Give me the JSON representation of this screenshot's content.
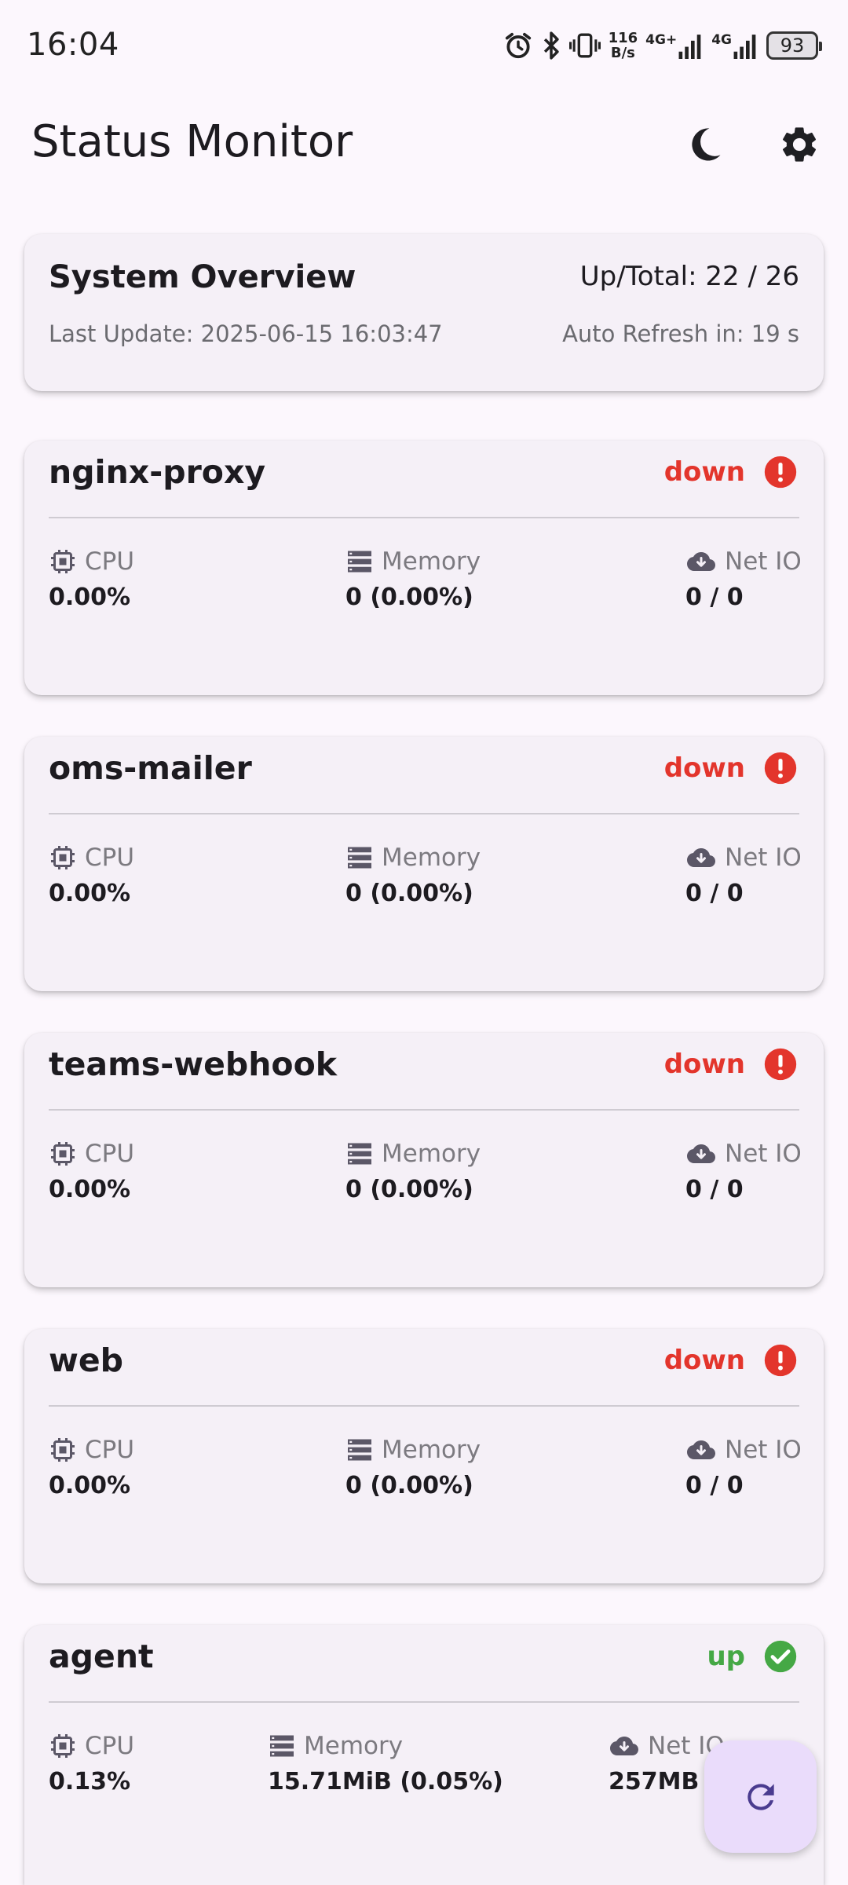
{
  "status_bar": {
    "time": "16:04",
    "net_speed_value": "116",
    "net_speed_unit": "B/s",
    "net_label_1": "4G+",
    "net_label_2": "4G",
    "battery": "93"
  },
  "app_bar": {
    "title": "Status Monitor",
    "icons": [
      "moon-icon",
      "gear-icon"
    ]
  },
  "overview": {
    "title": "System Overview",
    "up_total": "Up/Total: 22 / 26",
    "last_update": "Last Update: 2025-06-15 16:03:47",
    "auto_refresh": "Auto Refresh in: 19 s"
  },
  "metric_labels": {
    "cpu": "CPU",
    "memory": "Memory",
    "net_io": "Net IO"
  },
  "services": [
    {
      "name": "nginx-proxy",
      "status": "down",
      "cpu": "0.00%",
      "memory": "0 (0.00%)",
      "net_io": "0 / 0"
    },
    {
      "name": "oms-mailer",
      "status": "down",
      "cpu": "0.00%",
      "memory": "0 (0.00%)",
      "net_io": "0 / 0"
    },
    {
      "name": "teams-webhook",
      "status": "down",
      "cpu": "0.00%",
      "memory": "0 (0.00%)",
      "net_io": "0 / 0"
    },
    {
      "name": "web",
      "status": "down",
      "cpu": "0.00%",
      "memory": "0 (0.00%)",
      "net_io": "0 / 0"
    },
    {
      "name": "agent",
      "status": "up",
      "cpu": "0.13%",
      "memory": "15.71MiB (0.05%)",
      "net_io": "257MB /"
    }
  ],
  "colors": {
    "down": "#e3352c",
    "up": "#45a845",
    "background": "#fcf7fd",
    "card": "#f5f0f7",
    "fab": "#eadcfb",
    "icon": "#5b5767"
  },
  "fab": {
    "icon": "refresh-icon"
  }
}
